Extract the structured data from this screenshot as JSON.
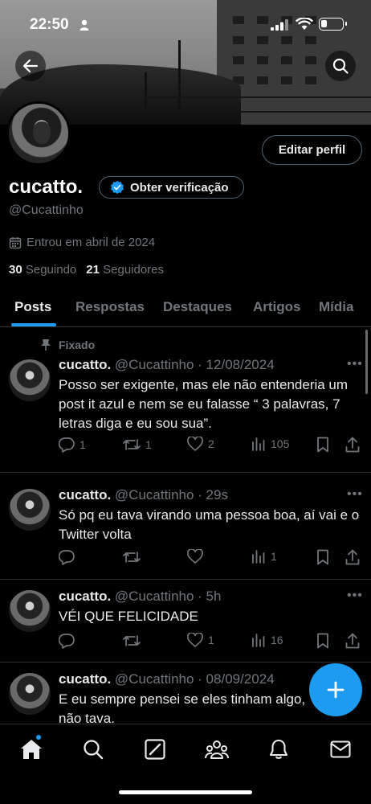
{
  "status_bar": {
    "time": "22:50"
  },
  "profile": {
    "name": "cucatto.",
    "verify_label": "Obter verificação",
    "handle": "@Cucattinho",
    "joined": "Entrou em abril de 2024",
    "following_count": "30",
    "following_label": "Seguindo",
    "followers_count": "21",
    "followers_label": "Seguidores",
    "edit_label": "Editar perfil"
  },
  "tabs": [
    {
      "label": "Posts",
      "active": true
    },
    {
      "label": "Respostas"
    },
    {
      "label": "Destaques"
    },
    {
      "label": "Artigos"
    },
    {
      "label": "Mídia"
    }
  ],
  "pinned_label": "Fixado",
  "posts": [
    {
      "name": "cucatto.",
      "handle_time": "@Cucattinho · 12/08/2024",
      "text": "Posso ser exigente, mas ele não entenderia um post it azul e nem se eu falasse “ 3 palavras, 7 letras diga e eu sou sua”.",
      "replies": "1",
      "reposts": "1",
      "likes": "2",
      "views": "105"
    },
    {
      "name": "cucatto.",
      "handle_time": "@Cucattinho · 29s",
      "text": "Só pq eu tava virando uma pessoa boa, aí vai e o Twitter volta",
      "replies": "",
      "reposts": "",
      "likes": "",
      "views": "1"
    },
    {
      "name": "cucatto.",
      "handle_time": "@Cucattinho · 5h",
      "text": "VÉI QUE FELICIDADE",
      "replies": "",
      "reposts": "",
      "likes": "1",
      "views": "16"
    },
    {
      "name": "cucatto.",
      "handle_time": "@Cucattinho · 08/09/2024",
      "text": "E eu sempre pensei se eles tinham algo, não tava."
    }
  ],
  "colors": {
    "accent": "#1d9bf0",
    "muted": "#71767b",
    "border": "#2f3336",
    "background": "#000000"
  },
  "icons": [
    "back-arrow-icon",
    "search-icon",
    "verified-badge-icon",
    "calendar-icon",
    "pin-icon",
    "reply-icon",
    "repost-icon",
    "like-icon",
    "views-icon",
    "bookmark-icon",
    "share-icon",
    "compose-plus-icon",
    "home-icon",
    "grok-icon",
    "communities-icon",
    "notifications-icon",
    "messages-icon"
  ]
}
